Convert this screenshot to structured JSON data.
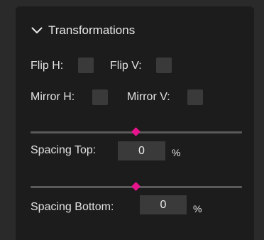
{
  "section": {
    "title": "Transformations",
    "icon": "chevron-down-icon"
  },
  "flip": {
    "h_label": "Flip H:",
    "v_label": "Flip V:"
  },
  "mirror": {
    "h_label": "Mirror H:",
    "v_label": "Mirror V:"
  },
  "spacing_top": {
    "label": "Spacing Top:",
    "value": "0",
    "unit": "%",
    "slider_fraction": 0.5
  },
  "spacing_bottom": {
    "label": "Spacing Bottom:",
    "value": "0",
    "unit": "%",
    "slider_fraction": 0.5
  },
  "colors": {
    "accent": "#e6148c",
    "panel_bg": "#1c1c1c",
    "window_bg": "#2a2a2a",
    "control_bg": "#3a3a3a"
  }
}
